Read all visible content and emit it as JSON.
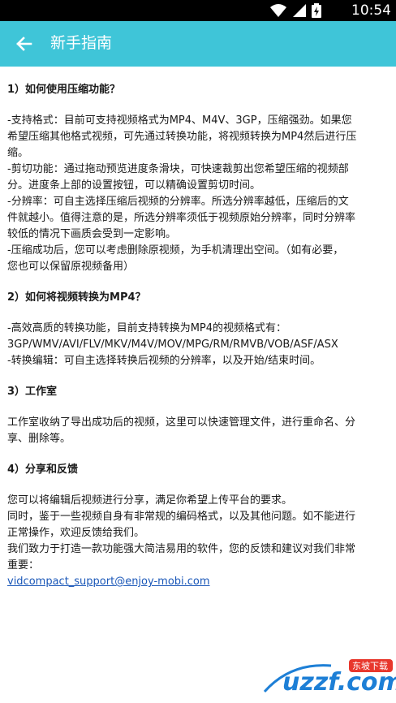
{
  "status": {
    "time": "10:54"
  },
  "appbar": {
    "title": "新手指南"
  },
  "sections": [
    {
      "heading": "1）如何使用压缩功能？",
      "lines": [
        "-支持格式：目前可支持视频格式为MP4、M4V、3GP，压缩强劲。如果您",
        "希望压缩其他格式视频，可先通过转换功能，将视频转换为MP4然后进行压",
        "缩。",
        "-剪切功能：通过拖动预览进度条滑块，可快速裁剪出您希望压缩的视频部",
        "分。进度条上部的设置按钮，可以精确设置剪切时间。",
        "-分辨率：可自主选择压缩后视频的分辨率。所选分辨率越低，压缩后的文",
        "件就越小。值得注意的是，所选分辨率须低于视频原始分辨率，同时分辨率",
        "较低的情况下画质会受到一定影响。",
        "-压缩成功后，您可以考虑删除原视频，为手机清理出空间。（如有必要，",
        "您也可以保留原视频备用）"
      ]
    },
    {
      "heading": "2）如何将视频转换为MP4？",
      "lines": [
        "-高效高质的转换功能，目前支持转换为MP4的视频格式有：",
        "3GP/WMV/AVI/FLV/MKV/M4V/MOV/MPG/RM/RMVB/VOB/ASF/ASX",
        "-转换编辑：可自主选择转换后视频的分辨率，以及开始/结束时间。"
      ]
    },
    {
      "heading": "3）工作室",
      "lines": [
        "工作室收纳了导出成功后的视频，这里可以快速管理文件，进行重命名、分",
        "享、删除等。"
      ]
    },
    {
      "heading": "4）分享和反馈",
      "lines": [
        "您可以将编辑后视频进行分享，满足你希望上传平台的要求。",
        "同时，鉴于一些视频自身有非常规的编码格式，以及其他问题。如不能进行",
        "正常操作，欢迎反馈给我们。",
        "我们致力于打造一款功能强大简洁易用的软件，您的反馈和建议对我们非常",
        "重要："
      ],
      "email": "vidcompact_support@enjoy-mobi.com"
    }
  ],
  "watermark": {
    "text": "uzzf.com",
    "badge": "东坡下载"
  },
  "colors": {
    "appbar": "#3fc5d8",
    "link": "#1a57b8"
  }
}
